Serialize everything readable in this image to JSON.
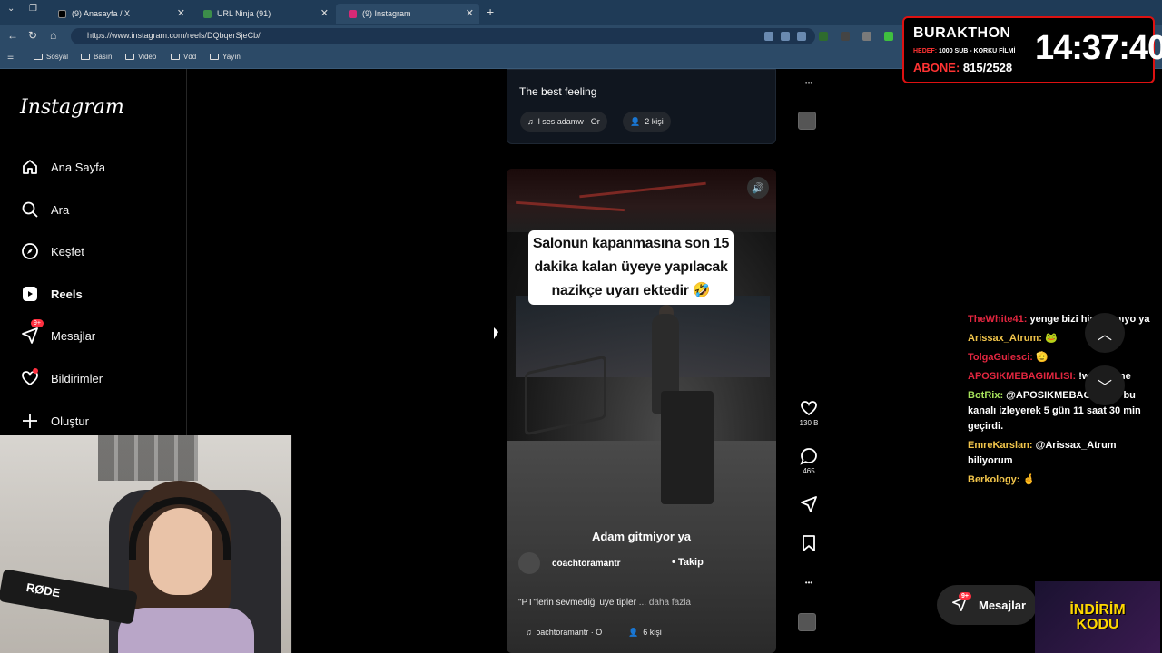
{
  "browser": {
    "tabs": [
      {
        "label": "(9) Anasayfa / X"
      },
      {
        "label": "URL Ninja (91)"
      },
      {
        "label": "(9) Instagram"
      }
    ],
    "url": "https://www.instagram.com/reels/DQbqerSjeCb/",
    "bookmarks": [
      "Sosyal",
      "Basın",
      "Video",
      "Vdd",
      "Yayın"
    ]
  },
  "sidebar": {
    "logo": "Instagram",
    "items": [
      {
        "label": "Ana Sayfa",
        "icon": "home-icon"
      },
      {
        "label": "Ara",
        "icon": "search-icon"
      },
      {
        "label": "Keşfet",
        "icon": "compass-icon"
      },
      {
        "label": "Reels",
        "icon": "reels-icon"
      },
      {
        "label": "Mesajlar",
        "icon": "messages-icon",
        "badge": "9+"
      },
      {
        "label": "Bildirimler",
        "icon": "heart-icon"
      },
      {
        "label": "Oluştur",
        "icon": "plus-icon"
      }
    ]
  },
  "prev_post": {
    "caption": "The best feeling",
    "audio": "l ses  adamw · Or",
    "people": "2 kişi"
  },
  "reel": {
    "overlay_text": "Salonun kapanmasına son 15 dakika kalan üyeye yapılacak nazikçe uyarı  ektedir 🤣",
    "subtitle": "Adam gitmiyor ya",
    "author": "coachtoramantr",
    "follow_label": "Takip",
    "caption": "\"PT\"lerin sevmediği üye tipler",
    "more_label": "... daha fazla",
    "audio": "ɔachtoramantr · O",
    "people": "6 kişi",
    "likes": "130 B",
    "comments": "465"
  },
  "stream": {
    "title": "BURAKTHON",
    "goal_label": "HEDEF:",
    "goal_text": "1000 SUB - KORKU FİLMİ",
    "subs_label": "ABONE:",
    "subs_value": "815/2528",
    "clock": "14:37:40"
  },
  "chat": [
    {
      "user": "TheWhite41:",
      "text": "yenge bizi hiç takmıyo ya",
      "color": "red"
    },
    {
      "user": "Arissax_Atrum:",
      "text": "🐸",
      "color": "gold"
    },
    {
      "user": "TolgaGulesci:",
      "text": "🫡",
      "color": "orange"
    },
    {
      "user": "APOSIKMEBAGIMLISI:",
      "text": "!watchtime",
      "color": "red"
    },
    {
      "user": "BotRix:",
      "text": "@APOSIKMEBAGIMLISI bu kanalı izleyerek 5 gün 11 saat 30 min geçirdi.",
      "color": "green"
    },
    {
      "user": "EmreKarslan:",
      "text": "@Arissax_Atrum biliyorum",
      "color": "gold"
    },
    {
      "user": "Berkology:",
      "text": "🤞",
      "color": "gold"
    }
  ],
  "messages_button": {
    "label": "Mesajlar",
    "badge": "9+"
  },
  "promo": {
    "line1": "İNDİRİM",
    "line2": "KODU"
  },
  "webcam": {
    "mic_brand": "RØDE"
  }
}
